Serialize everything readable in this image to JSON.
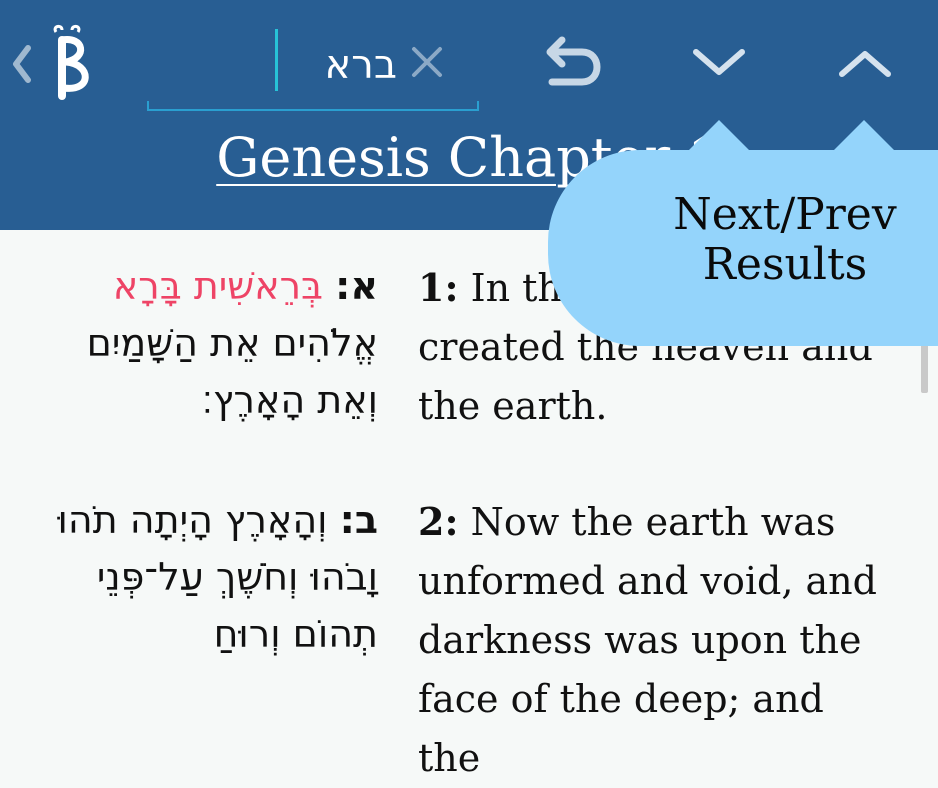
{
  "toolbar": {
    "search": {
      "value": "ברא"
    },
    "colors": {
      "bar": "#285e93",
      "accent": "#27c3d8",
      "highlight": "#ee4466",
      "tooltip": "#94d4fb"
    }
  },
  "chapter": {
    "title": "Genesis Chapter 1"
  },
  "verses": [
    {
      "heb_num": "א:",
      "heb_pre": "",
      "heb_hl1": "בְּרֵאשִׁית",
      "heb_mid": " ",
      "heb_hl2": "בָּרָא",
      "heb_rest": "אֱלֹהִים אֵת הַשָּׁמַיִם וְאֵת הָאָרֶץ׃",
      "eng_num": "1:",
      "eng_text": "In the beginning God created the heaven and the earth."
    },
    {
      "heb_num": "ב:",
      "heb_text": "וְהָאָרֶץ הָיְתָה תֹהוּ וָבֹהוּ וְחֹשֶׁךְ עַל־פְּנֵי תְהוֹם וְרוּחַ",
      "eng_num": "2:",
      "eng_text": "Now the earth was unformed and void, and darkness was upon the face of the deep; and the"
    }
  ],
  "tooltip": {
    "line1": "Next/Prev",
    "line2": "Results"
  },
  "icons": {
    "back": "chevron-left-icon",
    "logo": "beta-logo-icon",
    "clear": "close-icon",
    "undo": "undo-icon",
    "next": "chevron-down-icon",
    "prev": "chevron-up-icon"
  }
}
